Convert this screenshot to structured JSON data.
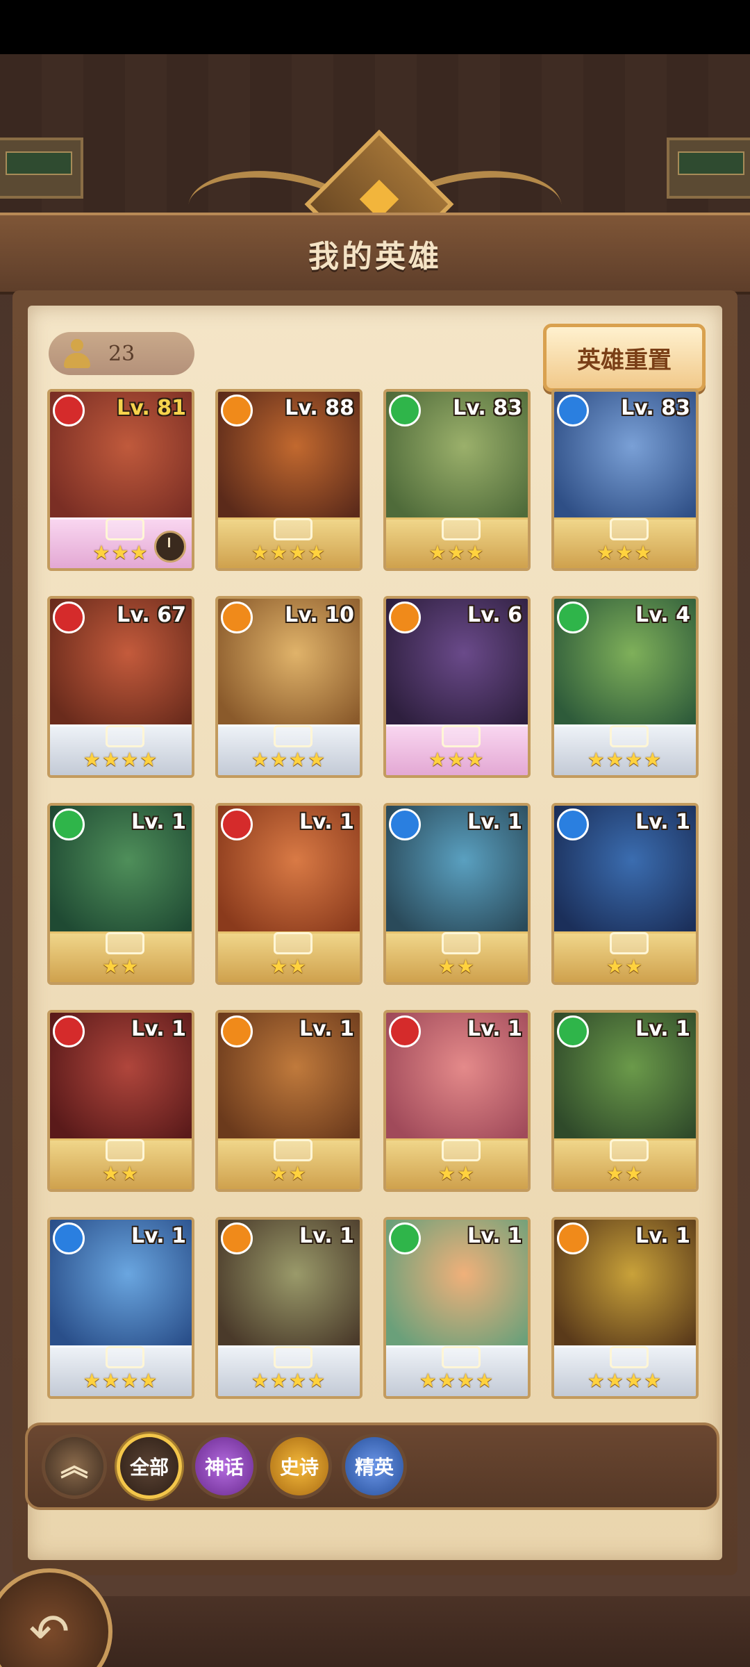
{
  "screen": {
    "title": "我的英雄"
  },
  "hero_count": "23",
  "reset_label": "英雄重置",
  "filters": [
    {
      "key": "collapse",
      "label": ""
    },
    {
      "key": "all",
      "label": "全部"
    },
    {
      "key": "myth",
      "label": "神话"
    },
    {
      "key": "epic",
      "label": "史诗"
    },
    {
      "key": "elite",
      "label": "精英"
    }
  ],
  "element_colors": {
    "fire": "#d52b2b",
    "light": "#f08a1a",
    "nature": "#2fb54a",
    "water": "#2a7fe0"
  },
  "heroes": [
    {
      "level": "Lv. 81",
      "element": "fire",
      "stars": 3,
      "frame": "legend",
      "timer": true,
      "level_gold": true,
      "art": [
        "#c05a3c",
        "#7a2e24"
      ]
    },
    {
      "level": "Lv. 88",
      "element": "light",
      "stars": 4,
      "frame": "gold",
      "art": [
        "#c2692f",
        "#5b2a1a"
      ]
    },
    {
      "level": "Lv. 83",
      "element": "nature",
      "stars": 3,
      "frame": "gold",
      "art": [
        "#9bb06b",
        "#4f6b3a"
      ]
    },
    {
      "level": "Lv. 83",
      "element": "water",
      "stars": 3,
      "frame": "gold",
      "art": [
        "#7aa0d6",
        "#2f4f86"
      ]
    },
    {
      "level": "Lv. 67",
      "element": "fire",
      "stars": 4,
      "frame": "silver",
      "art": [
        "#c45b3c",
        "#6a2b1c"
      ]
    },
    {
      "level": "Lv. 10",
      "element": "light",
      "stars": 4,
      "frame": "silver",
      "art": [
        "#e0b36a",
        "#8a5a2b"
      ]
    },
    {
      "level": "Lv. 6",
      "element": "light",
      "stars": 3,
      "frame": "legend",
      "art": [
        "#6a4a8a",
        "#2e1f3e"
      ]
    },
    {
      "level": "Lv. 4",
      "element": "nature",
      "stars": 4,
      "frame": "silver",
      "art": [
        "#7fb05a",
        "#2e5b3a"
      ]
    },
    {
      "level": "Lv. 1",
      "element": "nature",
      "stars": 2,
      "frame": "gold",
      "art": [
        "#4f8f5a",
        "#1f4a33"
      ]
    },
    {
      "level": "Lv. 1",
      "element": "fire",
      "stars": 2,
      "frame": "gold",
      "art": [
        "#d97a45",
        "#8a3a1c"
      ]
    },
    {
      "level": "Lv. 1",
      "element": "water",
      "stars": 2,
      "frame": "gold",
      "art": [
        "#5aa0c0",
        "#2a4a5a"
      ]
    },
    {
      "level": "Lv. 1",
      "element": "water",
      "stars": 2,
      "frame": "gold",
      "art": [
        "#3b6db0",
        "#1b2f5a"
      ]
    },
    {
      "level": "Lv. 1",
      "element": "fire",
      "stars": 2,
      "frame": "gold",
      "art": [
        "#b0463c",
        "#5a1a1a"
      ]
    },
    {
      "level": "Lv. 1",
      "element": "light",
      "stars": 2,
      "frame": "gold",
      "art": [
        "#c07a3c",
        "#6b3a1c"
      ]
    },
    {
      "level": "Lv. 1",
      "element": "fire",
      "stars": 2,
      "frame": "gold",
      "art": [
        "#e48a8a",
        "#a04a5a"
      ]
    },
    {
      "level": "Lv. 1",
      "element": "nature",
      "stars": 2,
      "frame": "gold",
      "art": [
        "#6b9a4a",
        "#2f4a2a"
      ]
    },
    {
      "level": "Lv. 1",
      "element": "water",
      "stars": 4,
      "frame": "silver",
      "art": [
        "#6aa6e0",
        "#2a4f8a"
      ]
    },
    {
      "level": "Lv. 1",
      "element": "light",
      "stars": 4,
      "frame": "silver",
      "art": [
        "#9a9a6a",
        "#4a3a2a"
      ]
    },
    {
      "level": "Lv. 1",
      "element": "nature",
      "stars": 4,
      "frame": "silver",
      "art": [
        "#f0b07a",
        "#6aa07a"
      ]
    },
    {
      "level": "Lv. 1",
      "element": "light",
      "stars": 4,
      "frame": "silver",
      "art": [
        "#c9a23a",
        "#5a3a1a"
      ]
    }
  ]
}
